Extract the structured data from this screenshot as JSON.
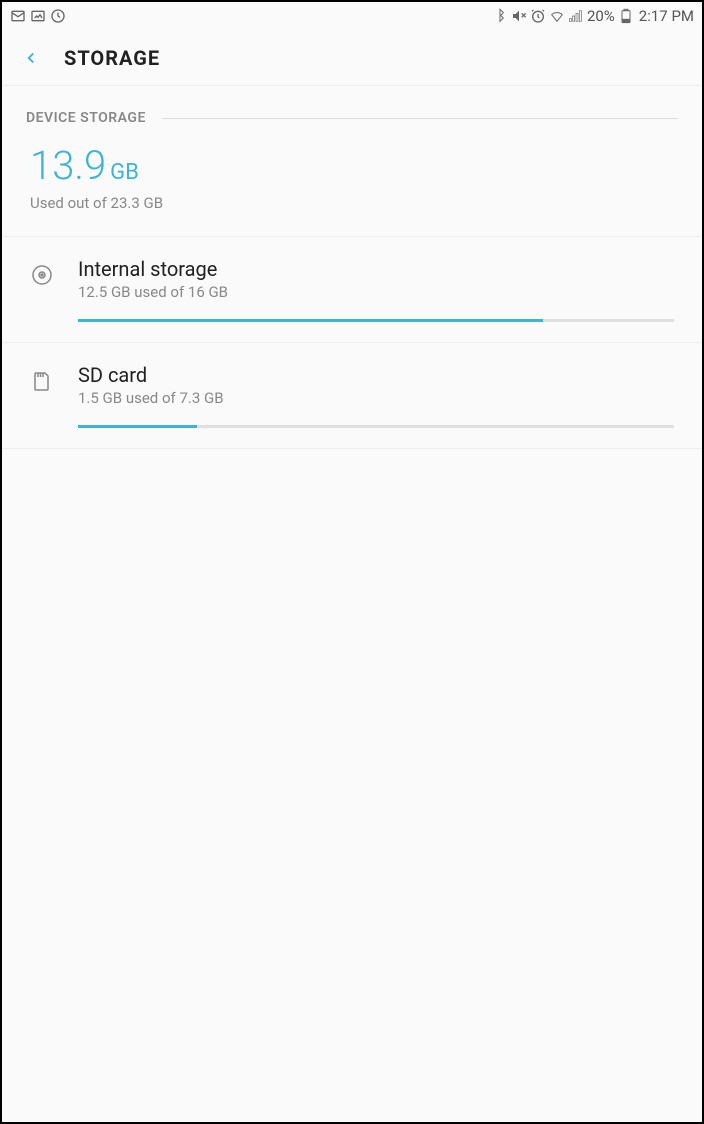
{
  "statusBar": {
    "batteryPercent": "20%",
    "time": "2:17 PM"
  },
  "appBar": {
    "title": "STORAGE"
  },
  "section": {
    "label": "DEVICE STORAGE"
  },
  "total": {
    "value": "13.9",
    "unit": "GB",
    "subtitle": "Used out of 23.3 GB"
  },
  "storages": {
    "internal": {
      "title": "Internal storage",
      "subtitle": "12.5 GB used of 16 GB",
      "percent": 78
    },
    "sdcard": {
      "title": "SD card",
      "subtitle": "1.5 GB used of 7.3 GB",
      "percent": 20
    }
  }
}
